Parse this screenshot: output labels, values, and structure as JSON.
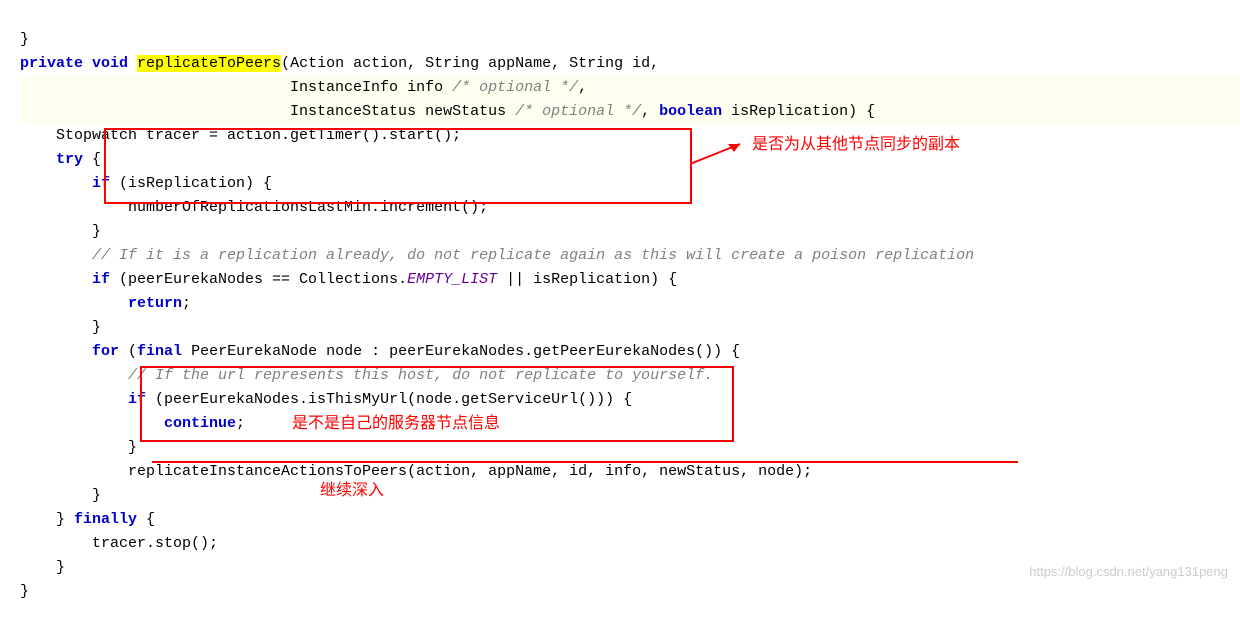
{
  "code": {
    "l1a": "}",
    "l2_kw1": "private void ",
    "l2_fn": "replicateToPeers",
    "l2_rest": "(Action action, String appName, String id,",
    "l3a": "                              InstanceInfo info ",
    "l3_comment": "/* optional */",
    "l3b": ",",
    "l4a": "                              InstanceStatus newStatus ",
    "l4_comment": "/* optional */",
    "l4b": ", ",
    "l4_kw": "boolean",
    "l4c": " isReplication) {",
    "l5": "    Stopwatch tracer = action.getTimer().start();",
    "l6_kw": "    try",
    "l6b": " {",
    "l7_kw": "        if",
    "l7b": " (isReplication) {",
    "l8": "            numberOfReplicationsLastMin.increment();",
    "l9": "        }",
    "l10_comment": "        // If it is a replication already, do not replicate again as this will create a poison replication",
    "l11_kw": "        if",
    "l11b": " (peerEurekaNodes == Collections.",
    "l11_const": "EMPTY_LIST",
    "l11c": " || isReplication) {",
    "l12_kw": "            return",
    "l12b": ";",
    "l13": "        }",
    "l14": "",
    "l15_kw1": "        for",
    "l15b": " (",
    "l15_kw2": "final",
    "l15c": " PeerEurekaNode node : peerEurekaNodes.getPeerEurekaNodes()) {",
    "l16_comment": "            // If the url represents this host, do not replicate to yourself.",
    "l17_kw": "            if",
    "l17b": " (peerEurekaNodes.isThisMyUrl(node.getServiceUrl())) {",
    "l18_kw": "                continue",
    "l18b": ";",
    "l19": "            }",
    "l20": "            replicateInstanceActionsToPeers(action, appName, id, info, newStatus, node);",
    "l21": "        }",
    "l22a": "    } ",
    "l22_kw": "finally",
    "l22b": " {",
    "l23": "        tracer.stop();",
    "l24": "    }",
    "l25": "}"
  },
  "annotations": {
    "a1": "是否为从其他节点同步的副本",
    "a2": "是不是自己的服务器节点信息",
    "a3": "继续深入"
  },
  "watermark": "https://blog.csdn.net/yang131peng"
}
